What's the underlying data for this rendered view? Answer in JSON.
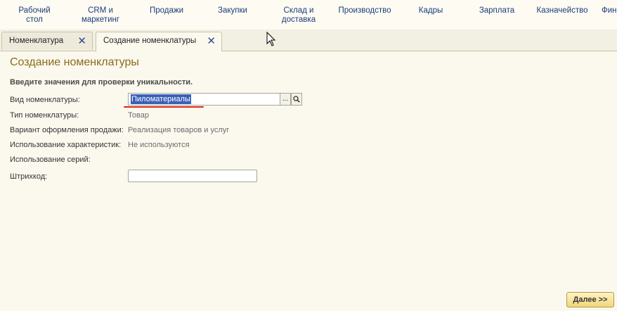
{
  "nav": {
    "items": [
      {
        "label": "Рабочий\nстол"
      },
      {
        "label": "CRM и\nмаркетинг"
      },
      {
        "label": "Продажи"
      },
      {
        "label": "Закупки"
      },
      {
        "label": "Склад и\nдоставка"
      },
      {
        "label": "Производство"
      },
      {
        "label": "Кадры"
      },
      {
        "label": "Зарплата"
      },
      {
        "label": "Казначейство"
      },
      {
        "label": "Фин"
      }
    ]
  },
  "tabs": [
    {
      "label": "Номенклатура",
      "active": false
    },
    {
      "label": "Создание номенклатуры",
      "active": true
    }
  ],
  "tab_close_glyph": "✕",
  "form": {
    "title": "Создание номенклатуры",
    "hint": "Введите значения для проверки уникальности.",
    "fields": {
      "kind_label": "Вид номенклатуры:",
      "kind_value": "Пиломатериалы",
      "type_label": "Тип номенклатуры:",
      "type_value": "Товар",
      "sale_variant_label": "Вариант оформления продажи:",
      "sale_variant_value": "Реализация товаров и услуг",
      "characteristics_label": "Использование характеристик:",
      "characteristics_value": "Не используются",
      "series_label": "Использование серий:",
      "barcode_label": "Штрихкод:",
      "barcode_value": ""
    },
    "select_glyph": "...",
    "search_glyph": "🔍"
  },
  "footer": {
    "next_label": "Далее >>"
  },
  "colors": {
    "accent_title": "#8a6c1a",
    "nav_text": "#1d3c7c",
    "selection": "#3a61b7",
    "underline": "#e0241a"
  }
}
